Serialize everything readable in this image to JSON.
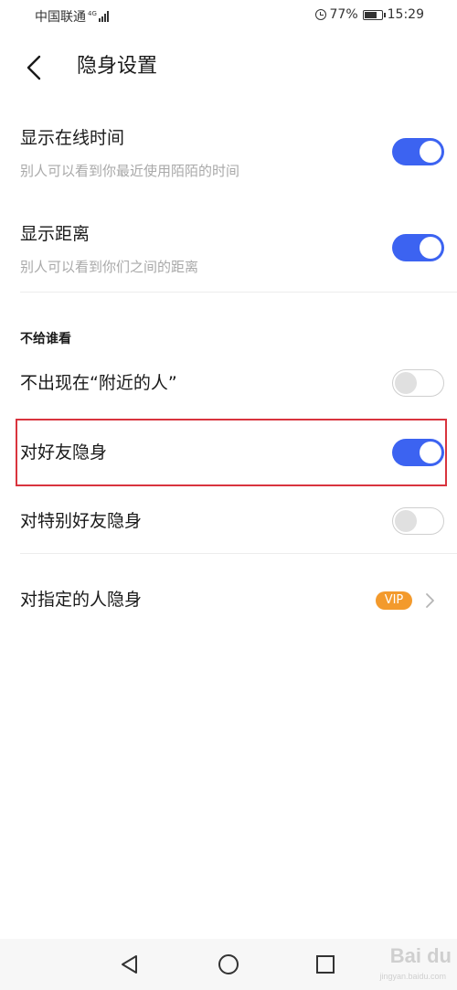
{
  "status_bar": {
    "carrier": "中国联通",
    "network_type": "4G",
    "battery_percent": "77%",
    "battery_level": 0.77,
    "time": "15:29"
  },
  "header": {
    "title": "隐身设置",
    "back_icon": "chevron-left-icon"
  },
  "settings": {
    "show_online_time": {
      "title": "显示在线时间",
      "subtitle": "别人可以看到你最近使用陌陌的时间",
      "enabled": true
    },
    "show_distance": {
      "title": "显示距离",
      "subtitle": "别人可以看到你们之间的距离",
      "enabled": true
    },
    "section_title": "不给谁看",
    "hide_from_nearby": {
      "title": "不出现在“附近的人”",
      "enabled": false
    },
    "hide_from_friends": {
      "title": "对好友隐身",
      "enabled": true
    },
    "hide_from_special_friends": {
      "title": "对特别好友隐身",
      "enabled": false
    },
    "hide_from_specific": {
      "title": "对指定的人隐身",
      "badge": "VIP"
    }
  },
  "colors": {
    "toggle_on": "#3c63f1",
    "vip_badge": "#f39a2c",
    "highlight": "#d9343e"
  },
  "watermark": {
    "text": "Bai du",
    "sub": "jingyan.baidu.com"
  }
}
